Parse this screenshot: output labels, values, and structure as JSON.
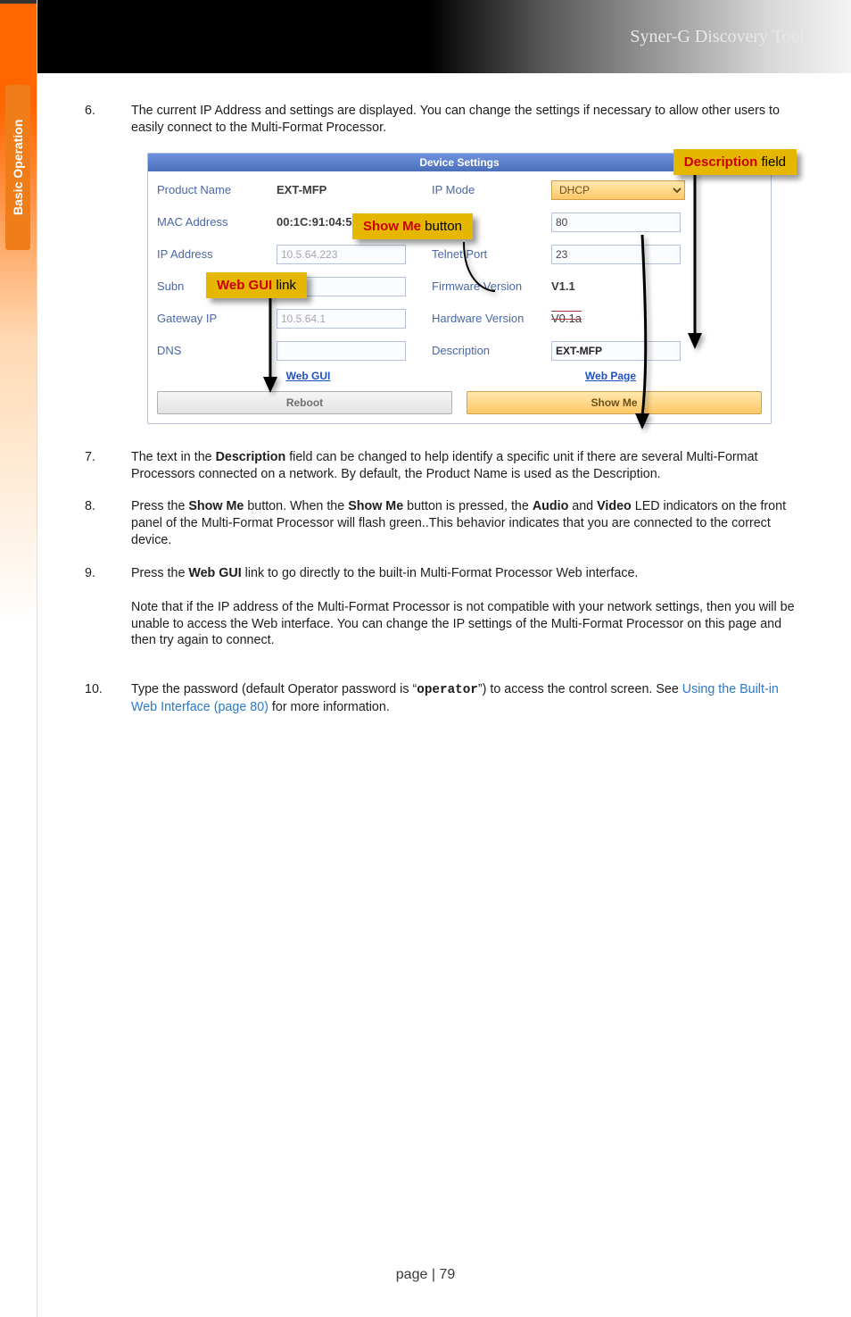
{
  "header": {
    "title": "Syner-G Discovery Tool"
  },
  "sidebar": {
    "tab_label": "Basic Operation"
  },
  "steps": {
    "s6": {
      "num": "6.",
      "text": "The current IP Address and settings are displayed.  You can change the settings if necessary to allow other users to easily connect to the Multi-Format Processor."
    },
    "s7": {
      "num": "7.",
      "text_pre": "The text in the ",
      "b1": "Description",
      "text_post": " field can be changed to help identify a specific unit if there are several Multi-Format Processors connected on a network.  By default, the Product Name is used as the Description."
    },
    "s8": {
      "num": "8.",
      "t1": "Press the ",
      "b1": "Show Me",
      "t2": " button.  When the ",
      "b2": "Show Me",
      "t3": " button is pressed, the ",
      "b3": "Audio",
      "t4": " and ",
      "b4": "Video",
      "t5": " LED indicators on the front panel of the Multi-Format Processor will flash green..This behavior indicates that you are connected to the correct device."
    },
    "s9": {
      "num": "9.",
      "t1": "Press the ",
      "b1": "Web GUI",
      "t2": " link to go directly to the built-in Multi-Format Processor Web interface.",
      "para2": "Note that if the IP address of the Multi-Format Processor is not compatible with your network settings, then you will be unable to access the Web interface.  You can change the IP settings of the Multi-Format Processor on this page and then try again to connect."
    },
    "s10": {
      "num": "10.",
      "t1": "Type the password (default Operator password is “",
      "code": "operator",
      "t2": "”) to access the control screen.  See ",
      "link": "Using the Built-in Web Interface (page 80)",
      "t3": " for more information."
    }
  },
  "panel": {
    "title": "Device Settings",
    "labels": {
      "product_name": "Product Name",
      "mac_address": "MAC Address",
      "ip_address": "IP Address",
      "subnet_mask": "Subn",
      "gateway_ip": "Gateway IP",
      "dns": "DNS",
      "ip_mode": "IP Mode",
      "http_port_hidden": "",
      "telnet_port": "Telnet Port",
      "firmware_version": "Firmware Version",
      "hardware_version": "Hardware Version",
      "description": "Description"
    },
    "values": {
      "product_name": "EXT-MFP",
      "mac_address": "00:1C:91:04:50:13",
      "ip_address": "10.5.64.223",
      "subnet_mask": "",
      "gateway_ip": "10.5.64.1",
      "dns": "",
      "ip_mode": "DHCP",
      "http_port": "80",
      "telnet_port": "23",
      "firmware_version": "V1.1",
      "hardware_version": "V0.1a",
      "description": "EXT-MFP"
    },
    "links": {
      "web_gui": "Web GUI",
      "web_page": "Web Page"
    },
    "buttons": {
      "reboot": "Reboot",
      "show_me": "Show Me"
    }
  },
  "callouts": {
    "description_prefix": "Description",
    "description_suffix": " field",
    "showme_prefix": "Show Me",
    "showme_suffix": " button",
    "webgui_prefix": "Web GUI",
    "webgui_suffix": " link"
  },
  "footer": {
    "page": "page | 79"
  }
}
